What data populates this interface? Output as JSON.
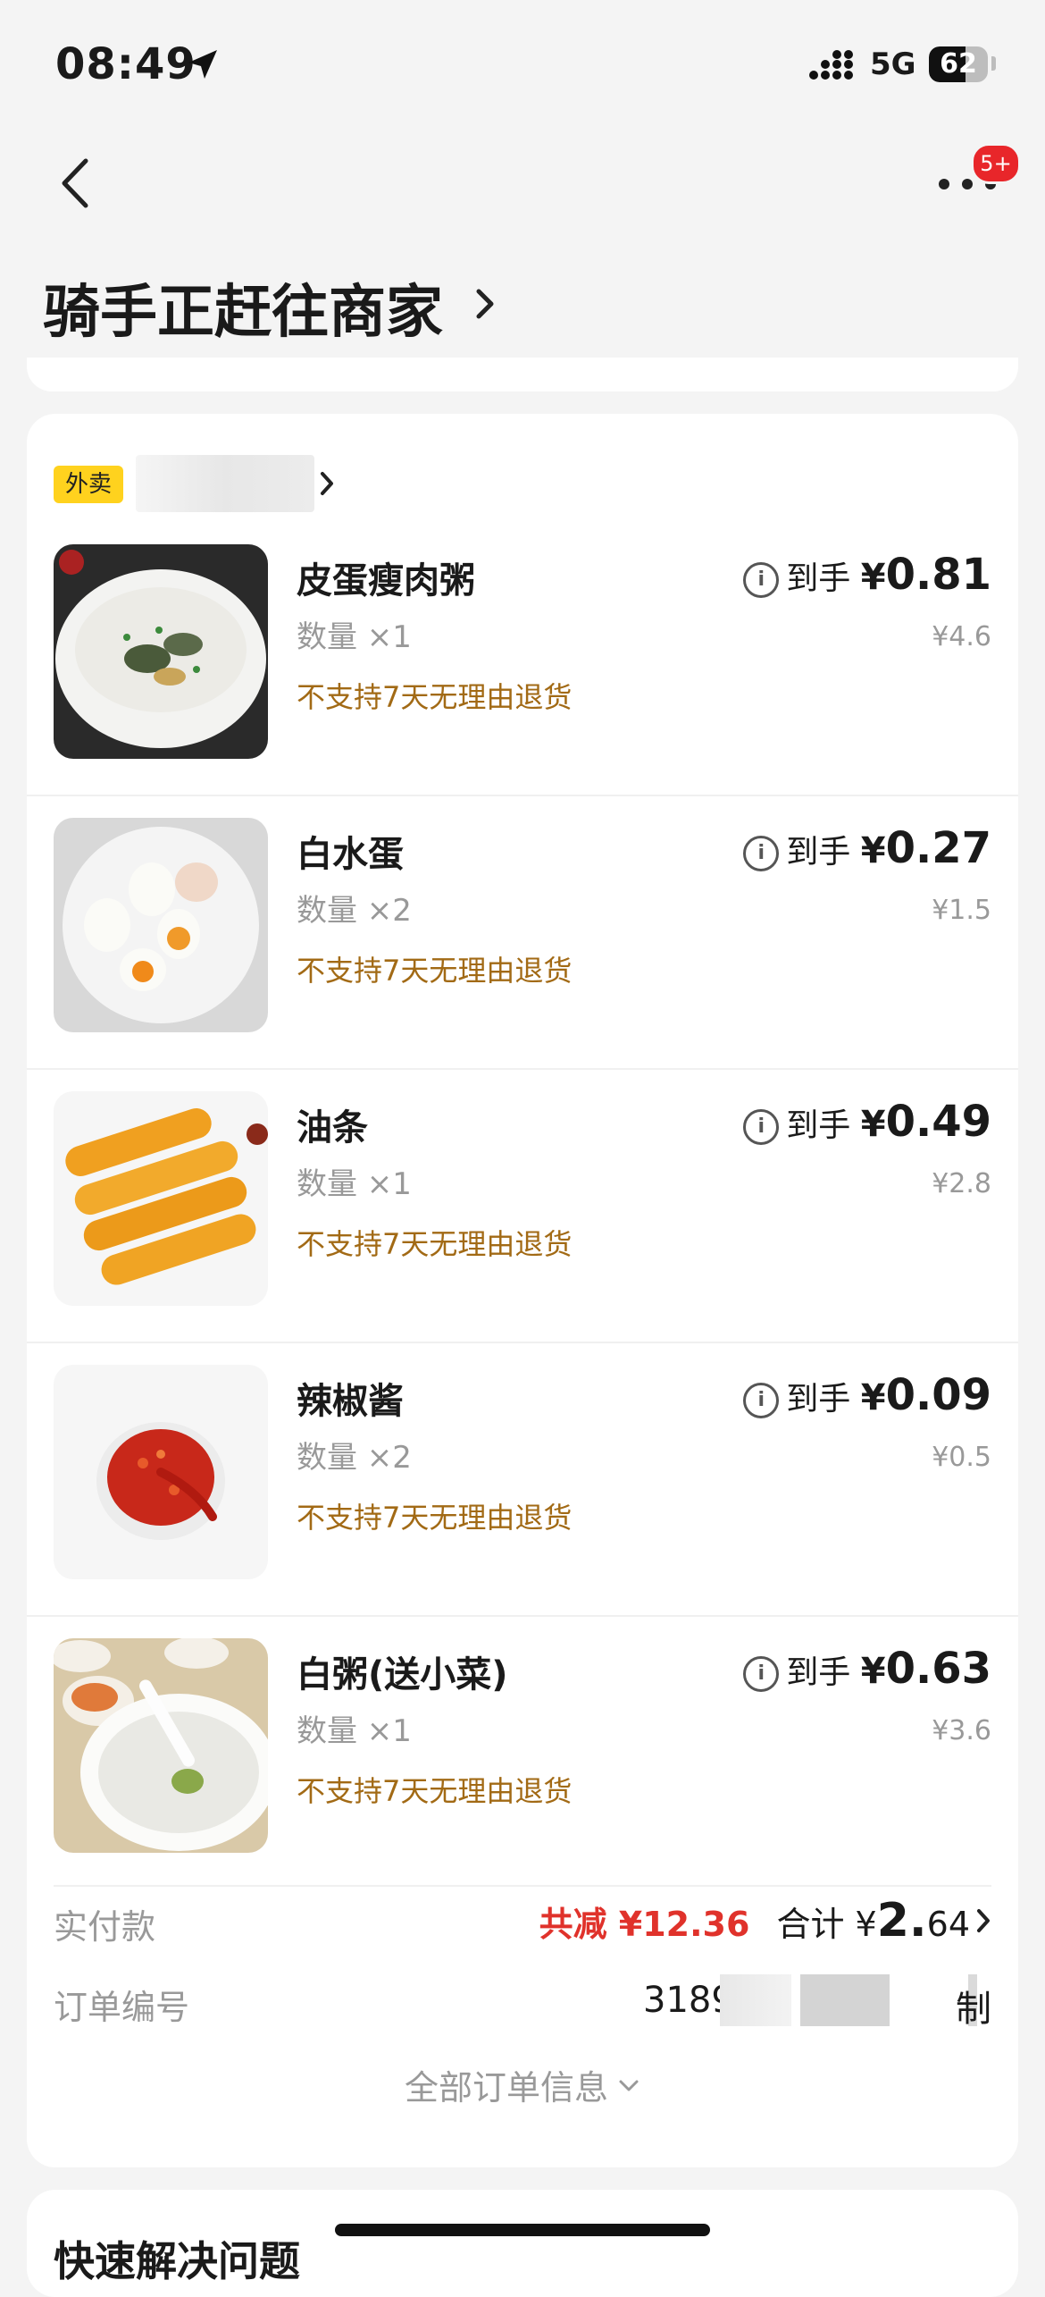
{
  "status_bar": {
    "time": "08:49",
    "network": "5G",
    "battery": "62",
    "battery_level": 0.62
  },
  "nav": {
    "badge": "5+"
  },
  "page_title": "骑手正赶往商家",
  "shop": {
    "tag": "外卖"
  },
  "items": [
    {
      "name": "皮蛋瘦肉粥",
      "qty": "数量 ×1",
      "return_policy": "不支持7天无理由退货",
      "price_label": "到手",
      "yen": "¥",
      "price": "0.81",
      "original": "¥4.6",
      "image": "porridge-image"
    },
    {
      "name": "白水蛋",
      "qty": "数量 ×2",
      "return_policy": "不支持7天无理由退货",
      "price_label": "到手",
      "yen": "¥",
      "price": "0.27",
      "original": "¥1.5",
      "image": "boiled-egg-image"
    },
    {
      "name": "油条",
      "qty": "数量 ×1",
      "return_policy": "不支持7天无理由退货",
      "price_label": "到手",
      "yen": "¥",
      "price": "0.49",
      "original": "¥2.8",
      "image": "fried-dough-image"
    },
    {
      "name": "辣椒酱",
      "qty": "数量 ×2",
      "return_policy": "不支持7天无理由退货",
      "price_label": "到手",
      "yen": "¥",
      "price": "0.09",
      "original": "¥0.5",
      "image": "chili-sauce-image"
    },
    {
      "name": "白粥(送小菜)",
      "qty": "数量 ×1",
      "return_policy": "不支持7天无理由退货",
      "price_label": "到手",
      "yen": "¥",
      "price": "0.63",
      "original": "¥3.6",
      "image": "white-porridge-image"
    }
  ],
  "payment": {
    "label": "实付款",
    "discount": "共减 ¥12.36",
    "total_label": "合计 ¥",
    "total_big": "2.",
    "total_small": "64"
  },
  "order": {
    "label": "订单编号",
    "number_prefix": "3189",
    "number_suffix": "制"
  },
  "all_info": "全部订单信息",
  "quick_solve": "快速解决问题",
  "colors": {
    "accent_red": "#e0322b",
    "tag_yellow": "#ffd21e",
    "policy_brown": "#a26a15"
  }
}
